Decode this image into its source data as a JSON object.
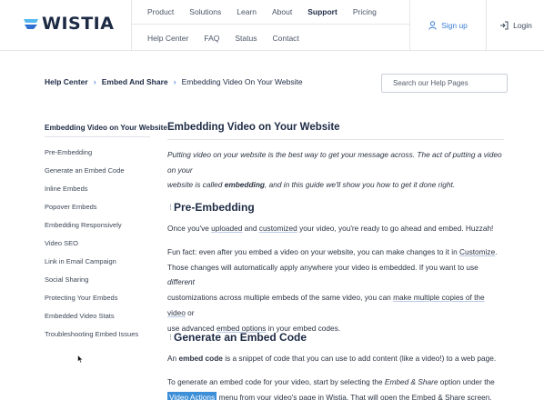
{
  "header": {
    "logo_text": "WISTIA",
    "nav_main": [
      "Product",
      "Solutions",
      "Learn",
      "About",
      "Support",
      "Pricing"
    ],
    "nav_active": "Support",
    "nav_sub": [
      "Help Center",
      "FAQ",
      "Status",
      "Contact"
    ],
    "signup_label": "Sign up",
    "login_label": "Login",
    "colors": {
      "brand": "#1d2a44",
      "accent": "#3a7bd5",
      "logo_mark": "#54b9f0"
    }
  },
  "breadcrumb": {
    "items": [
      "Help Center",
      "Embed And Share",
      "Embedding Video On Your Website"
    ],
    "separator": "›"
  },
  "search": {
    "placeholder": "Search our Help Pages"
  },
  "sidebar": {
    "title": "Embedding Video on Your Website",
    "items": [
      "Pre-Embedding",
      "Generate an Embed Code",
      "Inline Embeds",
      "Popover Embeds",
      "Embedding Responsively",
      "Video SEO",
      "Link in Email Campaign",
      "Social Sharing",
      "Protecting Your Embeds",
      "Embedded Video Stats",
      "Troubleshooting Embed Issues"
    ]
  },
  "main": {
    "title": "Embedding Video on Your Website",
    "intro_1": "Putting video on your website is the best way to get your message across. The act of putting a video on your",
    "intro_2a": "website is called ",
    "intro_2b": "embedding",
    "intro_2c": ", and in this guide we'll show you how to get it done right.",
    "sections": [
      {
        "heading": "Pre-Embedding",
        "p1_a": "Once you've ",
        "p1_link1": "uploaded",
        "p1_b": " and ",
        "p1_link2": "customized",
        "p1_c": " your video, you're ready to go ahead and embed. Huzzah!",
        "p2_l1a": "Fun fact: even after you embed a video on your website, you can make changes to it in ",
        "p2_l1link": "Customize",
        "p2_l1b": ".",
        "p2_l2a": "Those changes will automatically apply anywhere your video is embedded. If you want to use ",
        "p2_l2i": "different",
        "p2_l3a": "customizations across multiple embeds of the same video, you can ",
        "p2_l3link": "make multiple copies of the video",
        "p2_l3b": " or",
        "p2_l4a": "use advanced ",
        "p2_l4link": "embed options",
        "p2_l4b": " in your embed codes."
      },
      {
        "heading": "Generate an Embed Code",
        "p1_a": "An ",
        "p1_b": "embed code",
        "p1_c": " is a snippet of code that you can use to add content (like a video!) to a web page.",
        "p2_l1a": "To generate an embed code for your video, start by selecting the ",
        "p2_l1i": "Embed & Share",
        "p2_l1b": " option under the",
        "p2_l2link": "Video Actions",
        "p2_l2b": " menu from your video's page in Wistia. That will open the Embed & Share screen."
      }
    ]
  }
}
